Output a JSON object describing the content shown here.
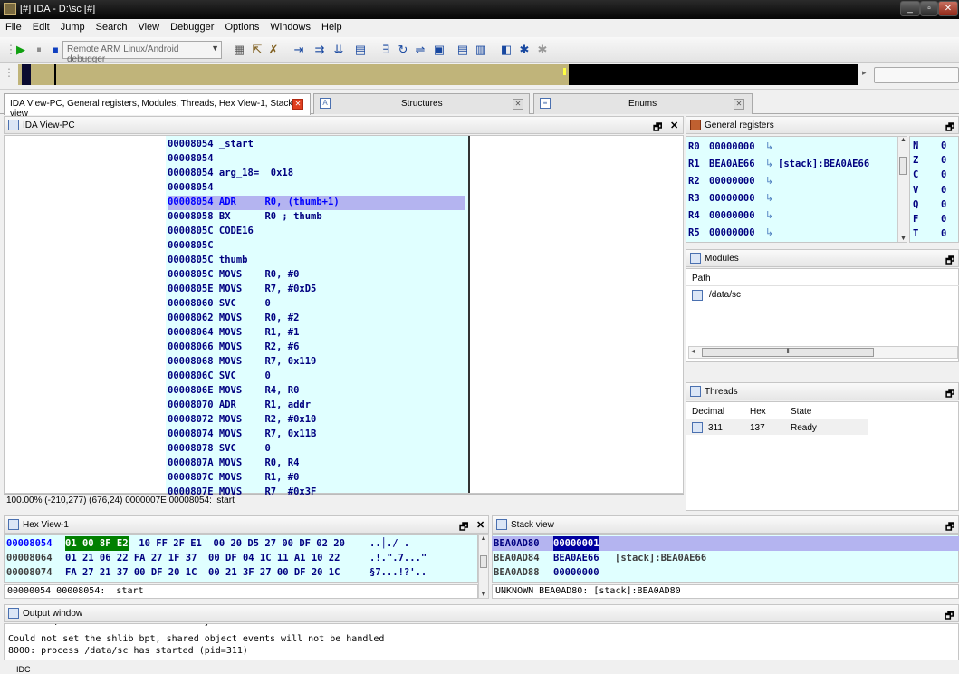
{
  "window": {
    "title": "[#] IDA - D:\\sc [#]"
  },
  "menu": [
    "File",
    "Edit",
    "Jump",
    "Search",
    "View",
    "Debugger",
    "Options",
    "Windows",
    "Help"
  ],
  "toolbar": {
    "debugger_select": "Remote ARM Linux/Android debugger"
  },
  "tabs": [
    {
      "label": "IDA View-PC, General registers, Modules, Threads, Hex View-1, Stack view"
    },
    {
      "label": "Structures"
    },
    {
      "label": "Enums"
    }
  ],
  "ida_view": {
    "title": "IDA View-PC",
    "lines": [
      "00008054 _start",
      "00008054",
      "00008054 arg_18=  0x18",
      "00008054",
      "00008054 ADR     R0, (thumb+1)",
      "00008058 BX      R0 ; thumb",
      "0000805C CODE16",
      "0000805C",
      "0000805C thumb",
      "0000805C MOVS    R0, #0",
      "0000805E MOVS    R7, #0xD5",
      "00008060 SVC     0",
      "00008062 MOVS    R0, #2",
      "00008064 MOVS    R1, #1",
      "00008066 MOVS    R2, #6",
      "00008068 MOVS    R7, 0x119",
      "0000806C SVC     0",
      "0000806E MOVS    R4, R0",
      "00008070 ADR     R1, addr",
      "00008072 MOVS    R2, #0x10",
      "00008074 MOVS    R7, 0x11B",
      "00008078 SVC     0",
      "0000807A MOVS    R0, R4",
      "0000807C MOVS    R1, #0",
      "0000807E MOVS    R7  #0x3F"
    ],
    "status": "100.00% (-210,277) (676,24) 0000007E 00008054:  start"
  },
  "registers": {
    "title": "General registers",
    "rows": [
      {
        "name": "R0",
        "value": "00000000",
        "note": ""
      },
      {
        "name": "R1",
        "value": "BEA0AE66",
        "note": "[stack]:BEA0AE66"
      },
      {
        "name": "R2",
        "value": "00000000",
        "note": ""
      },
      {
        "name": "R3",
        "value": "00000000",
        "note": ""
      },
      {
        "name": "R4",
        "value": "00000000",
        "note": ""
      },
      {
        "name": "R5",
        "value": "00000000",
        "note": ""
      }
    ],
    "flags": [
      {
        "name": "N",
        "value": "0"
      },
      {
        "name": "Z",
        "value": "0"
      },
      {
        "name": "C",
        "value": "0"
      },
      {
        "name": "V",
        "value": "0"
      },
      {
        "name": "Q",
        "value": "0"
      },
      {
        "name": "F",
        "value": "0"
      },
      {
        "name": "T",
        "value": "0"
      }
    ]
  },
  "modules": {
    "title": "Modules",
    "column": "Path",
    "items": [
      "/data/sc"
    ]
  },
  "threads": {
    "title": "Threads",
    "columns": [
      "Decimal",
      "Hex",
      "State"
    ],
    "rows": [
      {
        "decimal": "311",
        "hex": "137",
        "state": "Ready"
      }
    ]
  },
  "hexview": {
    "title": "Hex View-1",
    "rows": [
      {
        "addr": "00008054",
        "sel": "01 00 8F E2",
        "bytes": " 10 FF 2F E1  00 20 D5 27 00 DF 02 20",
        "ascii": "..│./ ."
      },
      {
        "addr": "00008064",
        "sel": "",
        "bytes": "01 21 06 22 FA 27 1F 37  00 DF 04 1C 11 A1 10 22",
        "ascii": ".!.\".7...\""
      },
      {
        "addr": "00008074",
        "sel": "",
        "bytes": "FA 27 21 37 00 DF 20 1C  00 21 3F 27 00 DF 20 1C",
        "ascii": "§7...!?'.."
      }
    ],
    "status": "00000054 00008054:  start"
  },
  "stackview": {
    "title": "Stack view",
    "rows": [
      {
        "addr": "BEA0AD80",
        "value": "00000001",
        "note": ""
      },
      {
        "addr": "BEA0AD84",
        "value": "BEA0AE66",
        "note": "[stack]:BEA0AE66"
      },
      {
        "addr": "BEA0AD88",
        "value": "00000000",
        "note": ""
      }
    ],
    "status": "UNKNOWN BEA0AD80: [stack]:BEA0AD80"
  },
  "output": {
    "title": "Output window",
    "lines": [
      "Could not set the shlib bpt, shared object events will not be handled",
      "8000: process /data/sc has started (pid=311)"
    ],
    "cmd_label": "IDC"
  },
  "colors": {
    "cyan": "#e0ffff",
    "highlight": "#b4b4f0",
    "navy": "#000080",
    "green": "#008000"
  }
}
